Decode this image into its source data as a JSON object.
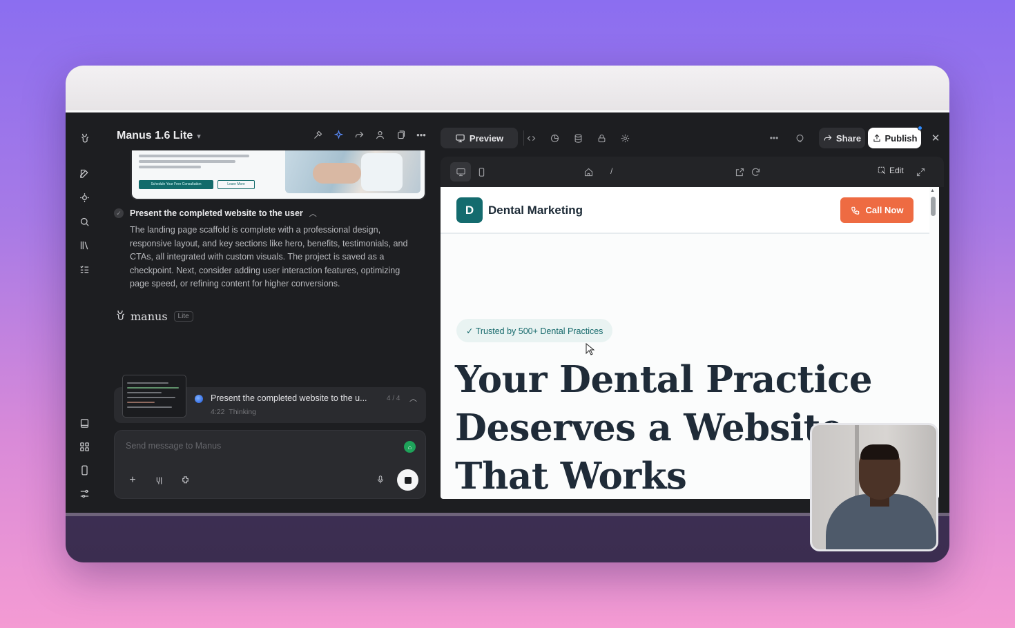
{
  "chat": {
    "model_name": "Manus 1.6 Lite",
    "thumbnail": {
      "primary_cta": "Schedule Your Free Consultation",
      "secondary_cta": "Learn More"
    },
    "step": {
      "title": "Present the completed website to the user",
      "body": "The landing page scaffold is complete with a professional design, responsive layout, and key sections like hero, benefits, testimonials, and CTAs, all integrated with custom visuals. The project is saved as a checkpoint. Next, consider adding user interaction features, optimizing page speed, or refining content for higher conversions."
    },
    "brand": {
      "name": "manus",
      "badge": "Lite"
    },
    "task": {
      "title": "Present the completed website to the u...",
      "count": "4 / 4",
      "time": "4:22",
      "status": "Thinking"
    },
    "composer": {
      "placeholder": "Send message to Manus"
    }
  },
  "preview": {
    "tab_label": "Preview",
    "share_label": "Share",
    "publish_label": "Publish",
    "url": "/",
    "edit_label": "Edit",
    "site": {
      "logo_letter": "D",
      "brand": "Dental Marketing",
      "call_button": "Call Now",
      "trust_badge": "✓ Trusted by 500+ Dental Practices",
      "hero_title": "Your Dental Practice Deserves a Website That Works"
    }
  },
  "colors": {
    "background_top": "#8b6ef0",
    "background_bottom": "#f49bd3",
    "app_bg": "#1d1e21",
    "brand_teal": "#146b6e",
    "cta_orange": "#ee6b42"
  }
}
